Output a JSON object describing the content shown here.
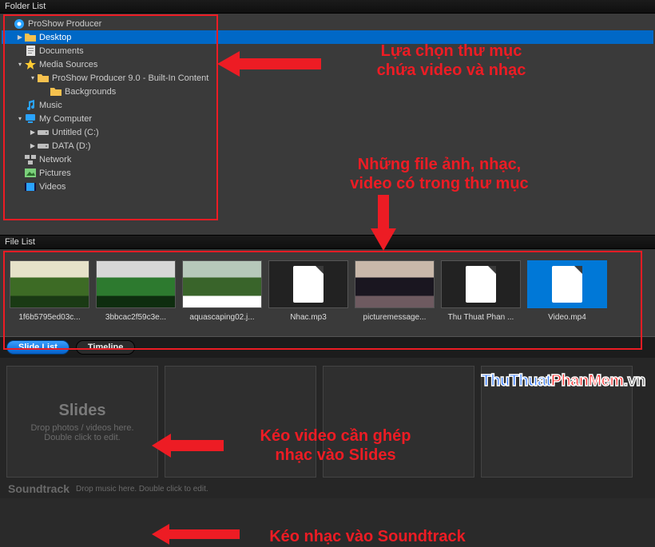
{
  "folder": {
    "title": "Folder List",
    "tree": [
      {
        "label": "ProShow Producer",
        "indent": 0,
        "arrow": "",
        "icon": "app"
      },
      {
        "label": "Desktop",
        "indent": 1,
        "arrow": "▶",
        "icon": "folder",
        "selected": true
      },
      {
        "label": "Documents",
        "indent": 1,
        "arrow": "",
        "icon": "doc"
      },
      {
        "label": "Media Sources",
        "indent": 1,
        "arrow": "▾",
        "icon": "star"
      },
      {
        "label": "ProShow Producer 9.0 - Built-In Content",
        "indent": 2,
        "arrow": "▾",
        "icon": "folder"
      },
      {
        "label": "Backgrounds",
        "indent": 3,
        "arrow": "",
        "icon": "folder"
      },
      {
        "label": "Music",
        "indent": 1,
        "arrow": "",
        "icon": "music"
      },
      {
        "label": "My Computer",
        "indent": 1,
        "arrow": "▾",
        "icon": "computer"
      },
      {
        "label": "Untitled (C:)",
        "indent": 2,
        "arrow": "▶",
        "icon": "drive"
      },
      {
        "label": "DATA (D:)",
        "indent": 2,
        "arrow": "▶",
        "icon": "drive"
      },
      {
        "label": "Network",
        "indent": 1,
        "arrow": "",
        "icon": "network"
      },
      {
        "label": "Pictures",
        "indent": 1,
        "arrow": "",
        "icon": "pictures"
      },
      {
        "label": "Videos",
        "indent": 1,
        "arrow": "",
        "icon": "videos"
      }
    ]
  },
  "filelist": {
    "title": "File List",
    "items": [
      {
        "name": "1f6b5795ed03c...",
        "kind": "image",
        "colors": [
          "#3d6b25",
          "#1a3a14",
          "#e6e2c9"
        ]
      },
      {
        "name": "3bbcac2f59c3e...",
        "kind": "image",
        "colors": [
          "#2d7a2f",
          "#0e2d0f",
          "#d7d7d7"
        ]
      },
      {
        "name": "aquascaping02.j...",
        "kind": "image",
        "colors": [
          "#39642a",
          "#ffffff",
          "#b6c8ba"
        ]
      },
      {
        "name": "Nhac.mp3",
        "kind": "file"
      },
      {
        "name": "picturemessage...",
        "kind": "image",
        "colors": [
          "#1a1620",
          "#6e5a60",
          "#c9b8aa"
        ]
      },
      {
        "name": "Thu Thuat Phan ...",
        "kind": "file"
      },
      {
        "name": "Video.mp4",
        "kind": "file",
        "selected": true
      }
    ]
  },
  "bottom": {
    "tabs": {
      "slide": "Slide List",
      "timeline": "Timeline"
    },
    "slides_title": "Slides",
    "slides_hint1": "Drop photos / videos here.",
    "slides_hint2": "Double click to edit.",
    "soundtrack_label": "Soundtrack",
    "soundtrack_hint": "Drop music here. Double click to edit."
  },
  "annotations": {
    "a1_l1": "Lựa chọn thư mục",
    "a1_l2": "chứa video và nhạc",
    "a2_l1": "Những file ảnh, nhạc,",
    "a2_l2": "video có trong thư mục",
    "a3_l1": "Kéo video cần ghép",
    "a3_l2": "nhạc vào Slides",
    "a4": "Kéo nhạc vào Soundtrack"
  },
  "watermark": {
    "p1": "ThuThuat",
    "p2": "PhanMem",
    "p3": ".vn"
  }
}
